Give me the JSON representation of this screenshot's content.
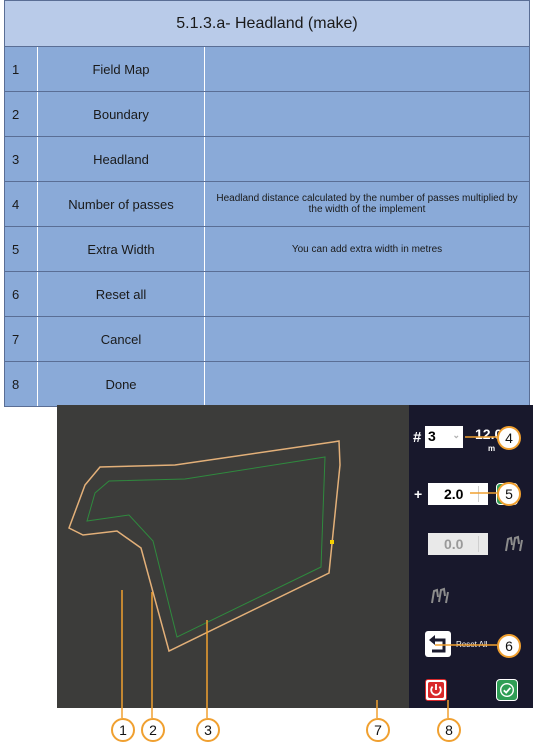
{
  "table": {
    "title": "5.1.3.a- Headland (make)",
    "rows": [
      {
        "num": "1",
        "name": "Field Map",
        "desc": ""
      },
      {
        "num": "2",
        "name": "Boundary",
        "desc": ""
      },
      {
        "num": "3",
        "name": "Headland",
        "desc": ""
      },
      {
        "num": "4",
        "name": "Number of passes",
        "desc": "Headland distance calculated by the number of passes multiplied by the width of the implement"
      },
      {
        "num": "5",
        "name": "Extra Width",
        "desc": "You can add extra width in metres"
      },
      {
        "num": "6",
        "name": "Reset all",
        "desc": ""
      },
      {
        "num": "7",
        "name": "Cancel",
        "desc": ""
      },
      {
        "num": "8",
        "name": "Done",
        "desc": ""
      }
    ]
  },
  "screen": {
    "passes_symbol": "#",
    "passes_value": "3",
    "distance_value": "12.00",
    "distance_unit": "m",
    "extra_symbol": "+",
    "extra_value": "2.0",
    "second_value": "0.0",
    "reset_label": "Reset All"
  },
  "callouts": [
    "1",
    "2",
    "3",
    "4",
    "5",
    "6",
    "7",
    "8"
  ],
  "colors": {
    "table_header": "#b9cbe9",
    "table_body": "#8aaad8",
    "map_background": "#3c3c3a",
    "panel_background": "#18182c",
    "boundary_line": "#e3b079",
    "headland_line": "#2f8a3e",
    "callout_ring": "#f0a030",
    "done_green": "#2f9e55",
    "cancel_red": "#d8282a"
  }
}
